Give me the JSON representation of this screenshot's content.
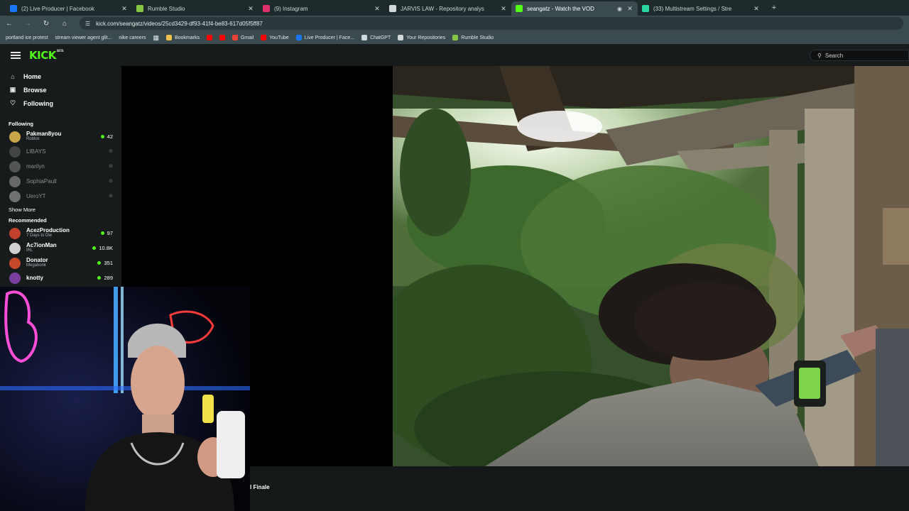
{
  "browser": {
    "tabs": [
      {
        "title": "(2) Live Producer | Facebook",
        "icon": "facebook-icon",
        "color": "#1877f2"
      },
      {
        "title": "Rumble Studio",
        "icon": "rumble-icon",
        "color": "#85c742"
      },
      {
        "title": "(9) Instagram",
        "icon": "instagram-icon",
        "color": "#e1306c"
      },
      {
        "title": "JARVIS LAW - Repository analys",
        "icon": "github-icon",
        "color": "#cfd8da"
      },
      {
        "title": "seangatz - Watch the VOD",
        "icon": "kick-icon",
        "color": "#53fc18"
      },
      {
        "title": "(33) Multistream Settings / Stre",
        "icon": "restream-icon",
        "color": "#2bd4a0"
      }
    ],
    "url": "kick.com/seangatz/videos/25cd3429-df93-41f4-be83-617d05f5ff87",
    "bookmarks": [
      {
        "label": "portland ice protest"
      },
      {
        "label": "stream viewer agent glit..."
      },
      {
        "label": "nike careers"
      },
      {
        "label": "Bookmarks",
        "icon": "star-icon",
        "color": "#f0c24b"
      },
      {
        "label": "Gmail",
        "icon": "gmail-icon",
        "color": "#ea4335"
      },
      {
        "label": "YouTube",
        "icon": "youtube-icon",
        "color": "#ff0000"
      },
      {
        "label": "Live Producer | Face...",
        "icon": "facebook-icon",
        "color": "#1877f2"
      },
      {
        "label": "ChatGPT",
        "icon": "chatgpt-icon",
        "color": "#cfd8da"
      },
      {
        "label": "Your Repositories",
        "icon": "github-icon",
        "color": "#cfd8da"
      },
      {
        "label": "Rumble Studio",
        "icon": "rumble-icon",
        "color": "#85c742"
      }
    ]
  },
  "kick": {
    "logo": "KICK",
    "search_placeholder": "Search",
    "accent": "#53fc18",
    "nav": [
      {
        "label": "Home",
        "icon": "home-icon"
      },
      {
        "label": "Browse",
        "icon": "browse-icon"
      },
      {
        "label": "Following",
        "icon": "heart-icon"
      }
    ],
    "following_header": "Following",
    "following": [
      {
        "name": "Pakman8you",
        "category": "Roblox",
        "viewers": "42",
        "live": true
      },
      {
        "name": "LIBAYS",
        "live": false
      },
      {
        "name": "marilyn",
        "live": false
      },
      {
        "name": "SophiaPaull",
        "live": false
      },
      {
        "name": "UeroYT",
        "live": false
      }
    ],
    "show_more": "Show More",
    "recommended_header": "Recommended",
    "recommended": [
      {
        "name": "AcezProduction",
        "category": "7 Days to Die",
        "viewers": "97"
      },
      {
        "name": "Ac7ionMan",
        "category": "IRL",
        "viewers": "10.8K"
      },
      {
        "name": "Donator",
        "category": "Megabonk",
        "viewers": "351"
      },
      {
        "name": "knotty",
        "category": "",
        "viewers": "289"
      }
    ],
    "below_text": "l Finale"
  }
}
